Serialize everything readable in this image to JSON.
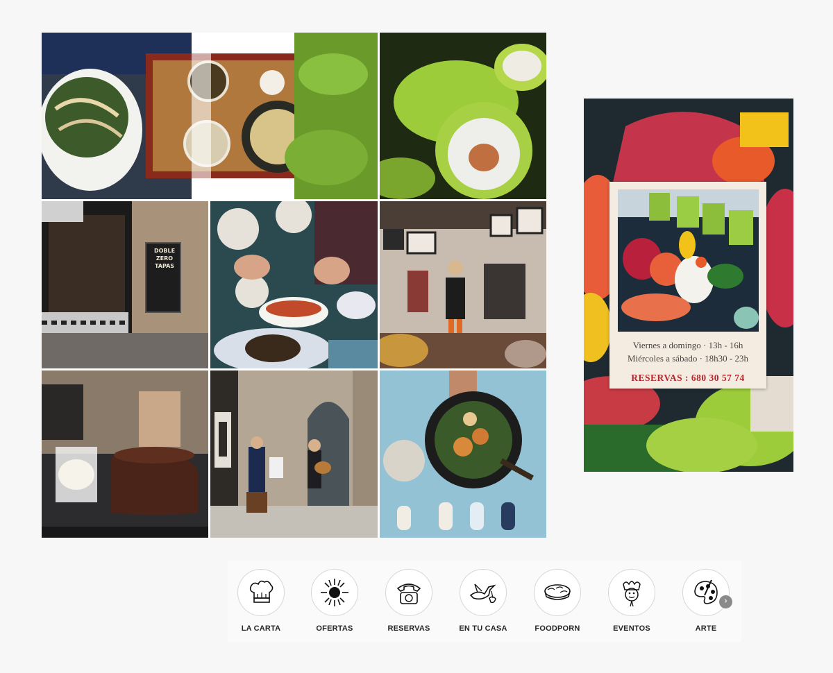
{
  "gallery": {
    "tiles": [
      {
        "name": "photo-soup-bowls",
        "tint": "#6a4a2a"
      },
      {
        "name": "photo-maki-rolls",
        "tint": "#7fae3a"
      },
      {
        "name": "photo-restaurant-entrance",
        "tint": "#5a4a3c"
      },
      {
        "name": "photo-woman-eating",
        "tint": "#2e4a5a"
      },
      {
        "name": "photo-shop-interior",
        "tint": "#6a5244"
      },
      {
        "name": "photo-chocolate-cake",
        "tint": "#3a2a20"
      },
      {
        "name": "photo-street-musicians",
        "tint": "#8a7a6a"
      },
      {
        "name": "photo-noodle-bowl",
        "tint": "#8ab8cc"
      }
    ],
    "sign_text": "DOBLE ZERO TAPAS"
  },
  "feature": {
    "hours_line1": "Viernes a domingo · 13h - 16h",
    "hours_line2": "Miércoles a sábado · 18h30 - 23h",
    "reservations": "RESERVAS : 680 30 57 74",
    "accent_color": "#b3262c"
  },
  "highlights": [
    {
      "label": "LA CARTA",
      "icon": "chef-hat-icon"
    },
    {
      "label": "OFERTAS",
      "icon": "sun-icon"
    },
    {
      "label": "RESERVAS",
      "icon": "telephone-icon"
    },
    {
      "label": "EN TU CASA",
      "icon": "stork-delivery-icon"
    },
    {
      "label": "FOODPORN",
      "icon": "sushi-roll-icon"
    },
    {
      "label": "EVENTOS",
      "icon": "jester-mask-icon"
    },
    {
      "label": "ARTE",
      "icon": "palette-icon"
    }
  ],
  "next_glyph": "›"
}
